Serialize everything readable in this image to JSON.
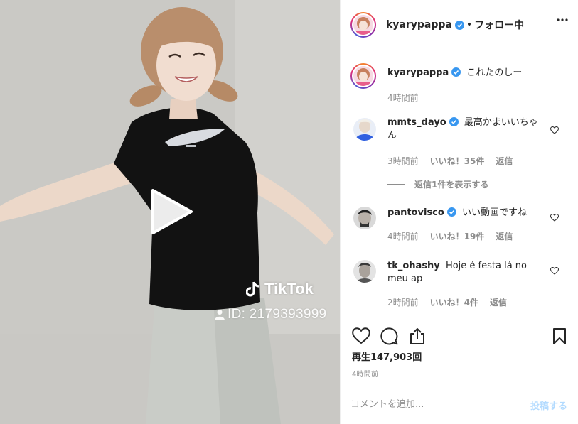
{
  "video": {
    "watermark_brand": "TikTok",
    "watermark_id": "ID: 2179393999",
    "play_icon": "play-icon"
  },
  "header": {
    "username": "kyarypappa",
    "separator": "•",
    "follow_status": "フォロー中",
    "more_icon": "more-horizontal-icon"
  },
  "caption": {
    "username": "kyarypappa",
    "text": "これたのしー",
    "time": "4時間前"
  },
  "comments": [
    {
      "username": "mmts_dayo",
      "verified": true,
      "text": "最高かまいいちゃん",
      "time": "3時間前",
      "likes": "いいね！35件",
      "reply": "返信",
      "view_replies": "返信1件を表示する"
    },
    {
      "username": "pantovisco",
      "verified": true,
      "text": "いい動画ですね",
      "time": "4時間前",
      "likes": "いいね！19件",
      "reply": "返信"
    },
    {
      "username": "tk_ohashy",
      "verified": false,
      "text": "Hoje é festa lá no meu ap",
      "time": "2時間前",
      "likes": "いいね！4件",
      "reply": "返信"
    }
  ],
  "actions": {
    "like_icon": "heart-icon",
    "comment_icon": "comment-icon",
    "share_icon": "share-icon",
    "save_icon": "bookmark-icon"
  },
  "views": "再生147,903回",
  "posted_ago": "4時間前",
  "add_comment": {
    "placeholder": "コメントを追加...",
    "post_label": "投稿する"
  },
  "colors": {
    "verified": "#3897f0",
    "post_disabled": "#b3dbff",
    "muted_text": "#8e8e8e"
  }
}
